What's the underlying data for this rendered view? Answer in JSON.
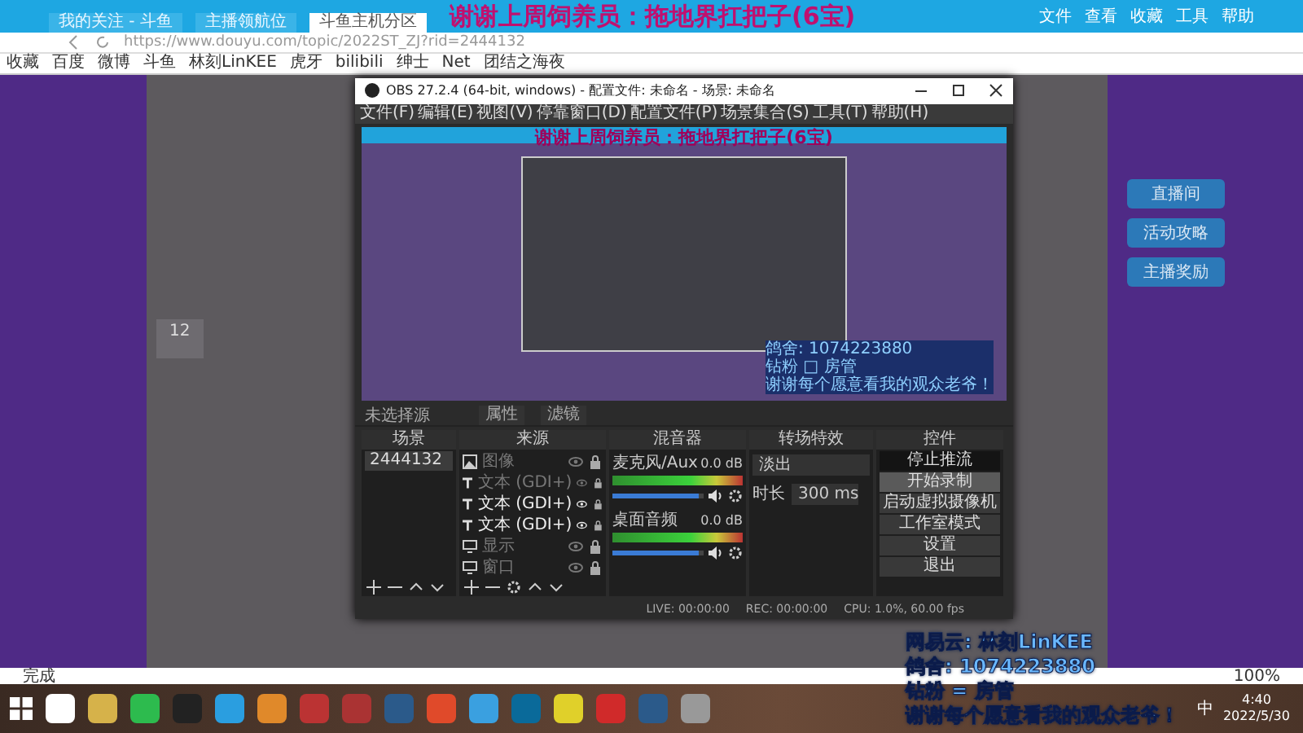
{
  "browser": {
    "tabs": [
      {
        "title": "我的关注 - 斗鱼",
        "selected": false
      },
      {
        "title": "主播领航位",
        "selected": false
      },
      {
        "title": "斗鱼主机分区",
        "selected": true
      }
    ],
    "menu": [
      "文件",
      "查看",
      "收藏",
      "工具",
      "帮助"
    ],
    "url": "https://www.douyu.com/topic/2022ST_ZJ?rid=2444132",
    "bookmarks": [
      "收藏",
      "百度",
      "微博",
      "斗鱼",
      "林刻LinKEE",
      "虎牙",
      "bilibili",
      "绅士",
      "Net",
      "团结之海夜"
    ],
    "status": "完成",
    "zoom": "100%"
  },
  "page": {
    "count": "12",
    "side_buttons": [
      "直播间",
      "活动攻略",
      "主播奖励"
    ]
  },
  "obs": {
    "title": "OBS 27.2.4 (64-bit, windows) - 配置文件: 未命名 - 场景: 未命名",
    "menu": [
      "文件(F)",
      "编辑(E)",
      "视图(V)",
      "停靠窗口(D)",
      "配置文件(P)",
      "场景集合(S)",
      "工具(T)",
      "帮助(H)"
    ],
    "preview": {
      "banner": "谢谢上周饲养员：拖地界扛把子(6宝)",
      "overlay_lines": [
        "鸽舍: 1074223880",
        "钻粉 □ 房管",
        "谢谢每个愿意看我的观众老爷！"
      ]
    },
    "toolbar": {
      "label": "未选择源",
      "buttons": [
        "属性",
        "滤镜"
      ]
    },
    "docks": {
      "scenes": {
        "title": "场景",
        "items": [
          {
            "name": "2444132",
            "selected": true
          }
        ]
      },
      "sources": {
        "title": "来源",
        "items": [
          {
            "name": "图像",
            "kind": "image",
            "visible": false
          },
          {
            "name": "文本 (GDI+)",
            "kind": "text",
            "visible": false
          },
          {
            "name": "文本 (GDI+)",
            "kind": "text",
            "visible": true
          },
          {
            "name": "文本 (GDI+)",
            "kind": "text",
            "visible": true
          },
          {
            "name": "显示",
            "kind": "display",
            "visible": false
          },
          {
            "name": "窗口",
            "kind": "display",
            "visible": false
          }
        ]
      },
      "mixer": {
        "title": "混音器",
        "channels": [
          {
            "name": "麦克风/Aux",
            "reading": "0.0 dB",
            "level": 0.95
          },
          {
            "name": "桌面音频",
            "reading": "0.0 dB",
            "level": 0.95
          }
        ]
      },
      "transitions": {
        "title": "转场特效",
        "value": "淡出",
        "duration_label": "时长",
        "duration": "300 ms"
      },
      "controls": {
        "title": "控件",
        "buttons": [
          {
            "label": "停止推流",
            "active": true,
            "hovered": false
          },
          {
            "label": "开始录制",
            "active": false,
            "hovered": true
          },
          {
            "label": "启动虚拟摄像机",
            "active": false,
            "hovered": false
          },
          {
            "label": "工作室模式",
            "active": false,
            "hovered": false
          },
          {
            "label": "设置",
            "active": false,
            "hovered": false
          },
          {
            "label": "退出",
            "active": false,
            "hovered": false
          }
        ]
      }
    },
    "status": {
      "live": "LIVE: 00:00:00",
      "rec": "REC: 00:00:00",
      "cpu": "CPU: 1.0%, 60.00 fps"
    }
  },
  "overlay": {
    "banner": "谢谢上周饲养员：拖地界扛把子(6宝)",
    "lines": [
      "网易云: 林刻LinKEE",
      "鸽舍: 1074223880",
      "钻粉 = 房管",
      "谢谢每个愿意看我的观众老爷！"
    ]
  },
  "taskbar": {
    "ime": "中",
    "time": "4:40",
    "date": "2022/5/30"
  }
}
